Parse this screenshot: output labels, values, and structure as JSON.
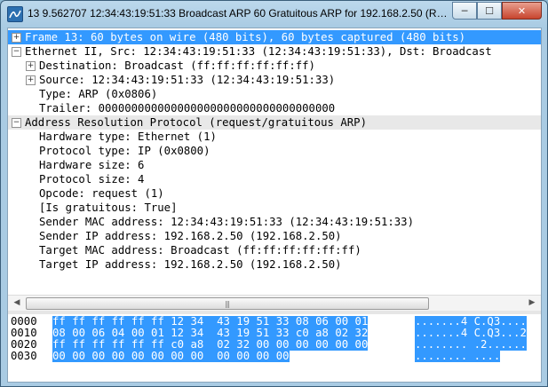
{
  "window": {
    "title": "13 9.562707 12:34:43:19:51:33 Broadcast ARP 60 Gratuitous ARP for 192.168.2.50 (Requ...",
    "minimize_symbol": "─",
    "maximize_symbol": "☐",
    "close_symbol": "✕"
  },
  "tree": [
    {
      "indent": 0,
      "expander": "+",
      "text": "Frame 13: 60 bytes on wire (480 bits), 60 bytes captured (480 bits)",
      "selected": true
    },
    {
      "indent": 0,
      "expander": "−",
      "text": "Ethernet II, Src: 12:34:43:19:51:33 (12:34:43:19:51:33), Dst: Broadcast"
    },
    {
      "indent": 1,
      "expander": "+",
      "text": "Destination: Broadcast (ff:ff:ff:ff:ff:ff)"
    },
    {
      "indent": 1,
      "expander": "+",
      "text": "Source: 12:34:43:19:51:33 (12:34:43:19:51:33)"
    },
    {
      "indent": 1,
      "expander": "",
      "text": "Type: ARP (0x0806)"
    },
    {
      "indent": 1,
      "expander": "",
      "text": "Trailer: 000000000000000000000000000000000000"
    },
    {
      "indent": 0,
      "expander": "−",
      "text": "Address Resolution Protocol (request/gratuitous ARP)",
      "highlight": true
    },
    {
      "indent": 1,
      "expander": "",
      "text": "Hardware type: Ethernet (1)"
    },
    {
      "indent": 1,
      "expander": "",
      "text": "Protocol type: IP (0x0800)"
    },
    {
      "indent": 1,
      "expander": "",
      "text": "Hardware size: 6"
    },
    {
      "indent": 1,
      "expander": "",
      "text": "Protocol size: 4"
    },
    {
      "indent": 1,
      "expander": "",
      "text": "Opcode: request (1)"
    },
    {
      "indent": 1,
      "expander": "",
      "text": "[Is gratuitous: True]"
    },
    {
      "indent": 1,
      "expander": "",
      "text": "Sender MAC address: 12:34:43:19:51:33 (12:34:43:19:51:33)"
    },
    {
      "indent": 1,
      "expander": "",
      "text": "Sender IP address: 192.168.2.50 (192.168.2.50)"
    },
    {
      "indent": 1,
      "expander": "",
      "text": "Target MAC address: Broadcast (ff:ff:ff:ff:ff:ff)"
    },
    {
      "indent": 1,
      "expander": "",
      "text": "Target IP address: 192.168.2.50 (192.168.2.50)"
    }
  ],
  "scrollbar": {
    "left_arrow": "◀",
    "right_arrow": "▶",
    "grip": "|||"
  },
  "hex": [
    {
      "offset": "0000",
      "bytes": "ff ff ff ff ff ff 12 34  43 19 51 33 08 06 00 01",
      "ascii": ".......4 C.Q3...."
    },
    {
      "offset": "0010",
      "bytes": "08 00 06 04 00 01 12 34  43 19 51 33 c0 a8 02 32",
      "ascii": ".......4 C.Q3...2"
    },
    {
      "offset": "0020",
      "bytes": "ff ff ff ff ff ff c0 a8  02 32 00 00 00 00 00 00",
      "ascii": "........ .2......"
    },
    {
      "offset": "0030",
      "bytes": "00 00 00 00 00 00 00 00  00 00 00 00",
      "ascii": "........ ...."
    }
  ],
  "colors": {
    "selection": "#3399ff",
    "title_bar": "#a9cbe3"
  }
}
